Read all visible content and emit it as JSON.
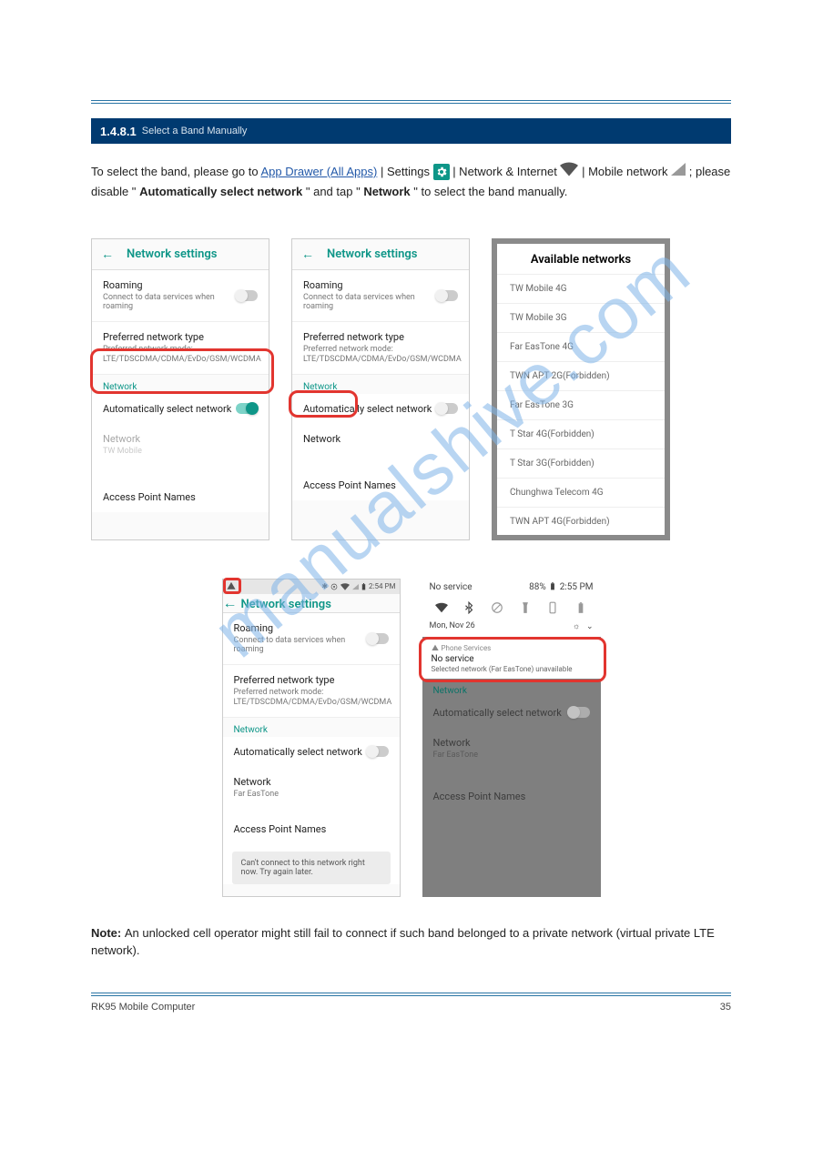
{
  "header": {
    "title": "1.4.8.1",
    "sub": "Select a Band Manually"
  },
  "intro": {
    "line1a": "To select the band, please go to ",
    "link": "App Drawer (All Apps)",
    "line1b": " | Settings ",
    "line1c": " | Network & Internet ",
    "line1d": " | Mobile network ",
    "line1e": "; please disable \"",
    "auto": "Automatically select network",
    "line1f": "\" and tap \"",
    "netword": "Network",
    "line1g": "\" to select the band manually."
  },
  "screens": {
    "s1": {
      "heading": "Network settings",
      "roaming": "Roaming",
      "roaming_sub": "Connect to data services when roaming",
      "pref": "Preferred network type",
      "pref_sub": "Preferred network mode: LTE/TDSCDMA/CDMA/EvDo/GSM/WCDMA",
      "network_lbl": "Network",
      "auto": "Automatically select network",
      "network": "Network",
      "network_sub": "TW Mobile",
      "apn": "Access Point Names"
    },
    "s2": {
      "heading": "Network settings",
      "roaming": "Roaming",
      "roaming_sub": "Connect to data services when roaming",
      "pref": "Preferred network type",
      "pref_sub": "Preferred network mode: LTE/TDSCDMA/CDMA/EvDo/GSM/WCDMA",
      "network_lbl": "Network",
      "auto": "Automatically select network",
      "network": "Network",
      "apn": "Access Point Names"
    },
    "avail": {
      "title": "Available networks",
      "items": [
        "TW Mobile 4G",
        "TW Mobile 3G",
        "Far EasTone 4G",
        "TWN APT 2G(Forbidden)",
        "Far EasTone 3G",
        "T Star 4G(Forbidden)",
        "T Star 3G(Forbidden)",
        "Chunghwa Telecom 4G",
        "TWN APT 4G(Forbidden)"
      ]
    },
    "s4": {
      "time": "2:54 PM",
      "heading": "Network settings",
      "roaming": "Roaming",
      "roaming_sub": "Connect to data services when roaming",
      "pref": "Preferred network type",
      "pref_sub": "Preferred network mode: LTE/TDSCDMA/CDMA/EvDo/GSM/WCDMA",
      "network_lbl": "Network",
      "auto": "Automatically select network",
      "network": "Network",
      "network_sub": "Far EasTone",
      "apn": "Access Point Names",
      "toast": "Can't connect to this network right now. Try again later."
    },
    "shade": {
      "noservice": "No service",
      "batt": "88%",
      "time": "2:55 PM",
      "date": "Mon, Nov 26",
      "app": "Phone Services",
      "msg_t": "No service",
      "msg_s": "Selected network (Far EasTone) unavailable",
      "network_lbl": "Network",
      "auto": "Automatically select network",
      "network": "Network",
      "network_sub": "Far EasTone",
      "apn": "Access Point Names"
    }
  },
  "note": "An unlocked cell operator might still fail to connect if such band belonged to a private network (virtual private LTE network).",
  "footer": {
    "left": "RK95 Mobile Computer",
    "right": "35"
  }
}
